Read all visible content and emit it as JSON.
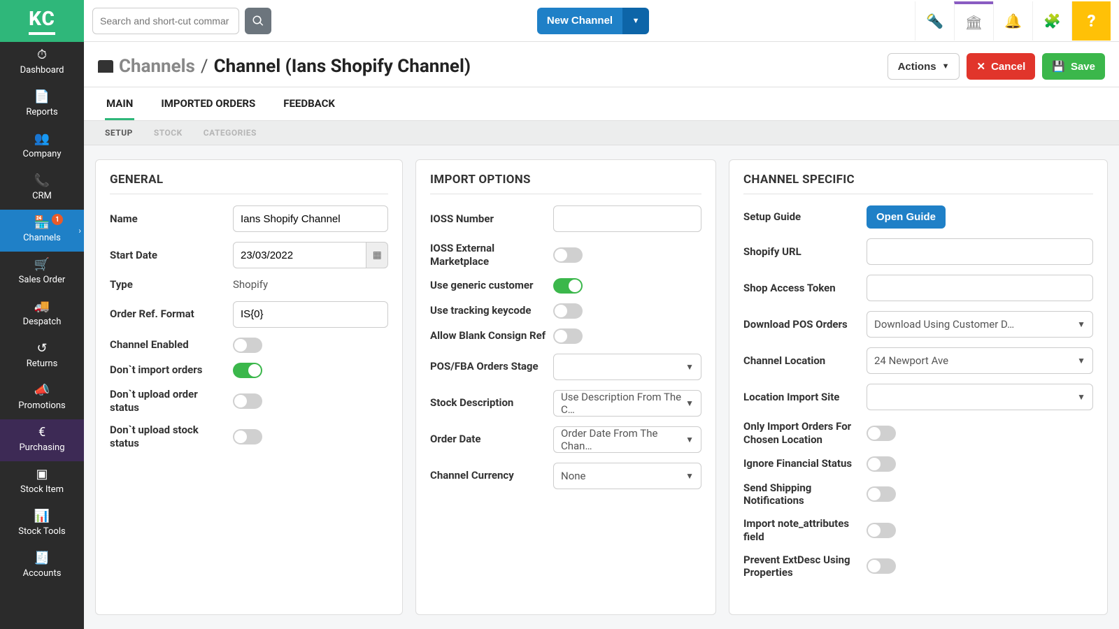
{
  "logo": "KC",
  "sidebar": {
    "items": [
      {
        "label": "Dashboard"
      },
      {
        "label": "Reports"
      },
      {
        "label": "Company"
      },
      {
        "label": "CRM"
      },
      {
        "label": "Channels",
        "badge": "1"
      },
      {
        "label": "Sales Order"
      },
      {
        "label": "Despatch"
      },
      {
        "label": "Returns"
      },
      {
        "label": "Promotions"
      },
      {
        "label": "Purchasing"
      },
      {
        "label": "Stock Item"
      },
      {
        "label": "Stock Tools"
      },
      {
        "label": "Accounts"
      }
    ]
  },
  "topbar": {
    "search_placeholder": "Search and short-cut commar",
    "new_channel": "New Channel"
  },
  "breadcrumb": {
    "root": "Channels",
    "sep": "/",
    "title": "Channel (Ians Shopify Channel)"
  },
  "actions": {
    "actions_label": "Actions",
    "cancel": "Cancel",
    "save": "Save"
  },
  "tabs_primary": [
    "MAIN",
    "IMPORTED ORDERS",
    "FEEDBACK"
  ],
  "tabs_secondary": [
    "SETUP",
    "STOCK",
    "CATEGORIES"
  ],
  "general": {
    "heading": "GENERAL",
    "name_label": "Name",
    "name_value": "Ians Shopify Channel",
    "start_date_label": "Start Date",
    "start_date_value": "23/03/2022",
    "type_label": "Type",
    "type_value": "Shopify",
    "order_ref_label": "Order Ref. Format",
    "order_ref_value": "IS{0}",
    "channel_enabled_label": "Channel Enabled",
    "dont_import_label": "Don`t import orders",
    "dont_upload_order_label": "Don`t upload order status",
    "dont_upload_stock_label": "Don`t upload stock status"
  },
  "import": {
    "heading": "IMPORT OPTIONS",
    "ioss_number_label": "IOSS Number",
    "ioss_ext_label": "IOSS External Marketplace",
    "use_generic_label": "Use generic customer",
    "use_tracking_label": "Use tracking keycode",
    "allow_blank_label": "Allow Blank Consign Ref",
    "pos_fba_label": "POS/FBA Orders Stage",
    "stock_desc_label": "Stock Description",
    "stock_desc_value": "Use Description From The C…",
    "order_date_label": "Order Date",
    "order_date_value": "Order Date From The Chan…",
    "currency_label": "Channel Currency",
    "currency_value": "None"
  },
  "specific": {
    "heading": "CHANNEL SPECIFIC",
    "setup_guide_label": "Setup Guide",
    "open_guide": "Open Guide",
    "shopify_url_label": "Shopify URL",
    "shop_token_label": "Shop Access Token",
    "download_pos_label": "Download POS Orders",
    "download_pos_value": "Download Using Customer D…",
    "channel_location_label": "Channel Location",
    "channel_location_value": "24 Newport Ave",
    "location_import_label": "Location Import Site",
    "only_import_label": "Only Import Orders For Chosen Location",
    "ignore_financial_label": "Ignore Financial Status",
    "send_shipping_label": "Send Shipping Notifications",
    "import_note_label": "Import note_attributes field",
    "prevent_ext_label": "Prevent ExtDesc Using Properties"
  }
}
